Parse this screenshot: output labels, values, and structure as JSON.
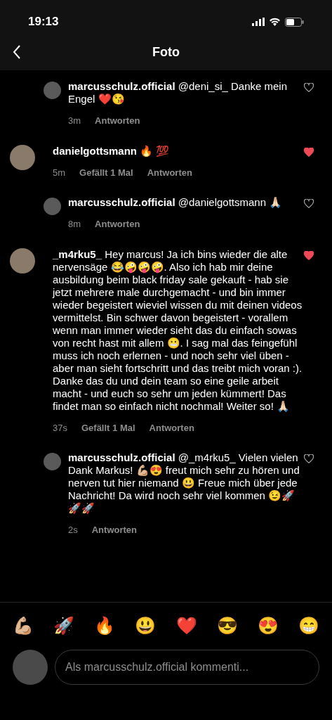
{
  "status_bar": {
    "time": "19:13"
  },
  "header": {
    "title": "Foto"
  },
  "comments": [
    {
      "kind": "reply",
      "username": "marcusschulz.official",
      "text": "@deni_si_ Danke mein Engel ❤️😘",
      "time": "3m",
      "reply_label": "Antworten",
      "liked": false
    },
    {
      "kind": "comment",
      "username": "danielgottsmann",
      "text": "🔥 💯",
      "time": "5m",
      "likes": "Gefällt 1 Mal",
      "reply_label": "Antworten",
      "liked": true
    },
    {
      "kind": "reply",
      "username": "marcusschulz.official",
      "text": "@danielgottsmann 🙏🏻",
      "time": "8m",
      "reply_label": "Antworten",
      "liked": false
    },
    {
      "kind": "comment",
      "username": "_m4rku5_",
      "text": "Hey marcus! Ja ich bins wieder die alte nervensäge 😂🤪🤪🤪. Also ich hab mir deine ausbildung beim black friday sale gekauft - hab sie jetzt mehrere male durchgemacht - und bin immer wieder begeistert wieviel wissen du mit deinen videos vermittelst. Bin schwer davon begeistert - vorallem wenn man immer wieder sieht das du einfach sowas von recht hast mit allem 😬. I sag mal das feingefühl muss ich noch erlernen - und noch sehr viel üben - aber man sieht fortschritt und das treibt mich voran :). Danke das du und dein team so eine geile arbeit macht - und euch so sehr um jeden kümmert! Das findet man so einfach nicht nochmal! Weiter so! 🙏🏻",
      "time": "37s",
      "likes": "Gefällt 1 Mal",
      "reply_label": "Antworten",
      "liked": true
    },
    {
      "kind": "reply",
      "username": "marcusschulz.official",
      "text": "@_m4rku5_ Vielen vielen Dank Markus! 💪🏼😍 freut mich sehr zu hören und nerven tut hier niemand 😃 Freue mich über jede Nachricht! Da wird noch sehr viel kommen 😉🚀🚀🚀",
      "time": "2s",
      "reply_label": "Antworten",
      "liked": false
    }
  ],
  "emoji_bar": [
    "💪🏼",
    "🚀",
    "🔥",
    "😃",
    "❤️",
    "😎",
    "😍",
    "😁"
  ],
  "composer": {
    "placeholder": "Als marcusschulz.official kommenti..."
  }
}
